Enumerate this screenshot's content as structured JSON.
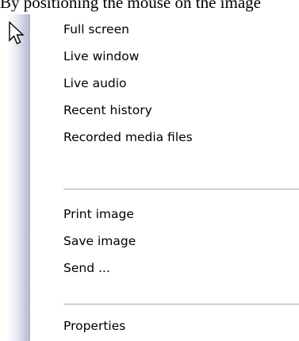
{
  "intro_text": "By positioning the mouse on the image",
  "menu": {
    "groups": [
      [
        "Full screen",
        "Live window",
        "Live audio",
        "Recent history",
        "Recorded media files"
      ],
      [
        "Print image",
        "Save image",
        "Send ..."
      ],
      [
        "Properties"
      ]
    ]
  },
  "icons": {
    "cursor": "mouse-pointer-icon"
  }
}
